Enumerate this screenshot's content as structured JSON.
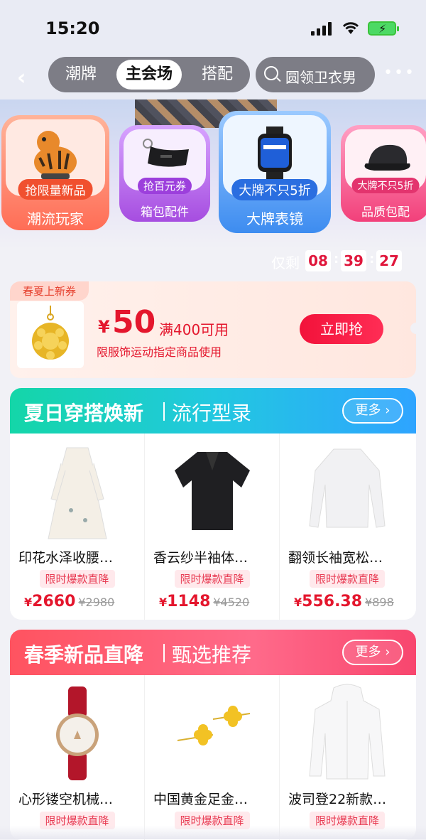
{
  "status": {
    "time": "15:20"
  },
  "nav": {
    "tabs": [
      {
        "label": "潮牌"
      },
      {
        "label": "主会场"
      },
      {
        "label": "搭配"
      }
    ],
    "search_placeholder": "圆领卫衣男"
  },
  "categories": [
    {
      "pill": "抢限量新品",
      "label": "潮流玩家"
    },
    {
      "pill": "抢百元券",
      "label": "箱包配件"
    },
    {
      "pill": "大牌不只5折",
      "label": "大牌表镜"
    },
    {
      "pill": "大牌不只5折",
      "label": "品质包配"
    }
  ],
  "timer": {
    "label": "仅剩",
    "h": "08",
    "m": "39",
    "s": "27"
  },
  "coupon": {
    "tag": "春夏上新券",
    "currency": "¥",
    "amount": "50",
    "condition": "满400可用",
    "note": "限服饰运动指定商品使用",
    "button": "立即抢"
  },
  "sections": [
    {
      "title": "夏日穿搭焕新",
      "subtitle": "流行型录",
      "more": "更多",
      "products": [
        {
          "name": "印花水泽收腰…",
          "tag": "限时爆款直降",
          "price": "2660",
          "old": "¥2980"
        },
        {
          "name": "香云纱半袖体…",
          "tag": "限时爆款直降",
          "price": "1148",
          "old": "¥4520"
        },
        {
          "name": "翻领长袖宽松…",
          "tag": "限时爆款直降",
          "price": "556.38",
          "old": "¥898"
        }
      ]
    },
    {
      "title": "春季新品直降",
      "subtitle": "甄选推荐",
      "more": "更多",
      "products": [
        {
          "name": "心形镂空机械…",
          "tag": "限时爆款直降"
        },
        {
          "name": "中国黄金足金…",
          "tag": "限时爆款直降"
        },
        {
          "name": "波司登22新款…",
          "tag": "限时爆款直降"
        }
      ]
    }
  ],
  "colors": {
    "accent": "#e4162d",
    "teal_banner": "#14d6a8",
    "pink_banner": "#ff5360"
  }
}
